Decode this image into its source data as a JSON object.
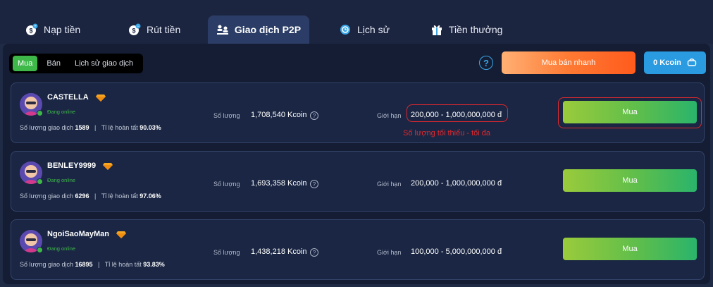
{
  "tabs": [
    {
      "label": "Nạp tiền",
      "icon": "deposit-icon"
    },
    {
      "label": "Rút tiền",
      "icon": "withdraw-icon"
    },
    {
      "label": "Giao dịch P2P",
      "icon": "p2p-users-icon",
      "active": true
    },
    {
      "label": "Lịch sử",
      "icon": "history-icon"
    },
    {
      "label": "Tiền thưởng",
      "icon": "gift-icon"
    }
  ],
  "subtabs": [
    {
      "label": "Mua",
      "active": true
    },
    {
      "label": "Bán"
    },
    {
      "label": "Lịch sử giao dịch"
    }
  ],
  "help_label": "?",
  "quick_trade_label": "Mua bán nhanh",
  "balance_label": "0 Kcoin",
  "offers": [
    {
      "username": "CASTELLA",
      "status": "Đang online",
      "trades_label": "Số lượng giao dịch",
      "trades": "1589",
      "completion_label": "Tỉ lệ hoàn tất",
      "completion": "90.03%",
      "qty_label": "Số lượng",
      "qty": "1,708,540 Kcoin",
      "limit_label": "Giới hạn",
      "limit": "200,000 - 1,000,000,000 đ",
      "buy_label": "Mua"
    },
    {
      "username": "BENLEY9999",
      "status": "Đang online",
      "trades_label": "Số lượng giao dịch",
      "trades": "6296",
      "completion_label": "Tỉ lệ hoàn tất",
      "completion": "97.06%",
      "qty_label": "Số lượng",
      "qty": "1,693,358 Kcoin",
      "limit_label": "Giới hạn",
      "limit": "200,000 - 1,000,000,000 đ",
      "buy_label": "Mua"
    },
    {
      "username": "NgoiSaoMayMan",
      "status": "Đang online",
      "trades_label": "Số lượng giao dịch",
      "trades": "16895",
      "completion_label": "Tỉ lệ hoàn tất",
      "completion": "93.83%",
      "qty_label": "Số lượng",
      "qty": "1,438,218 Kcoin",
      "limit_label": "Giới hạn",
      "limit": "100,000 - 5,000,000,000 đ",
      "buy_label": "Mua"
    }
  ],
  "annotation_text": "Số lượng tối thiểu - tối đa",
  "colors": {
    "background": "#1f2a44",
    "panel": "#141d33",
    "card": "#1a2643",
    "accent_green": "#3fb84a",
    "accent_blue": "#2a9be0",
    "accent_orange": "#ff7a33",
    "annotation_red": "#e0282e"
  }
}
